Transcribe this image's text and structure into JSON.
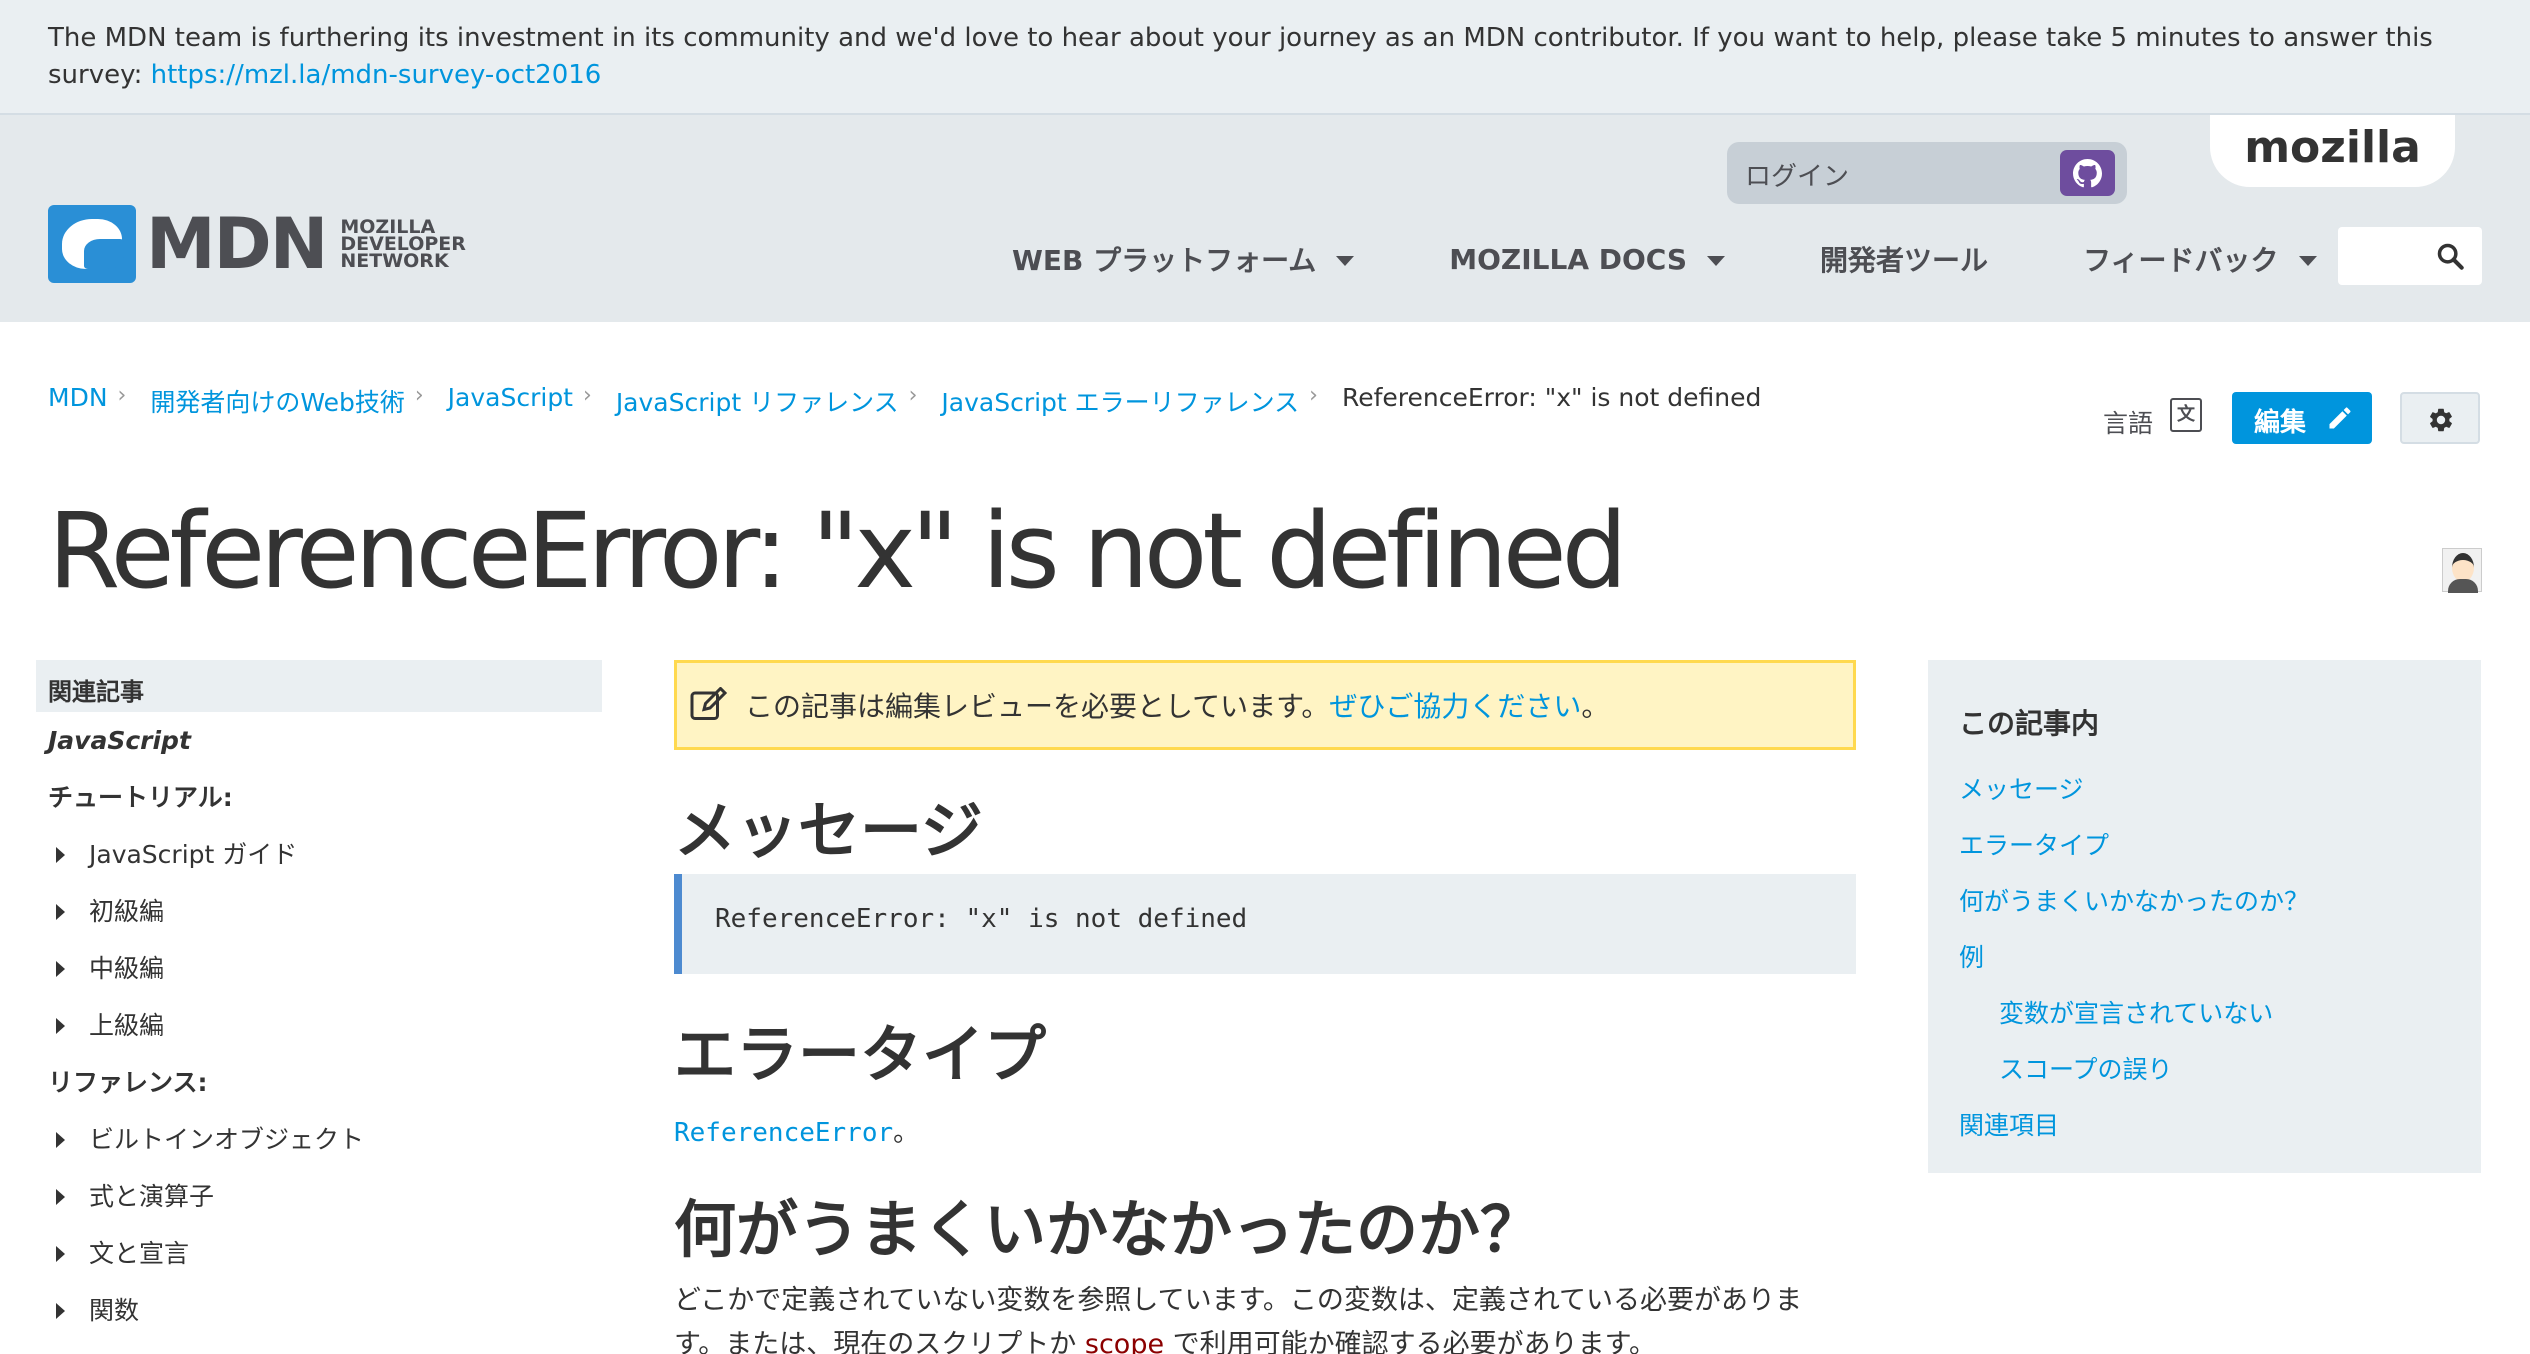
{
  "survey": {
    "text": "The MDN team is furthering its investment in its community and we'd love to hear about your journey as an MDN contributor. If you want to help, please take 5 minutes to answer this survey: ",
    "link": "https://mzl.la/mdn-survey-oct2016"
  },
  "header": {
    "logo_text": "MDN",
    "logo_sub_1": "MOZILLA",
    "logo_sub_2": "DEVELOPER",
    "logo_sub_3": "NETWORK",
    "mozilla_tab": "mozilla",
    "login_label": "ログイン",
    "nav": [
      {
        "label": "WEB プラットフォーム",
        "has_caret": true
      },
      {
        "label": "MOZILLA DOCS",
        "has_caret": true
      },
      {
        "label": "開発者ツール",
        "has_caret": false
      },
      {
        "label": "フィードバック",
        "has_caret": true
      }
    ],
    "search_icon": "search-icon"
  },
  "breadcrumbs": {
    "items": [
      "MDN",
      "開発者向けのWeb技術",
      "JavaScript",
      "JavaScript リファレンス",
      "JavaScript エラーリファレンス"
    ],
    "current": "ReferenceError: \"x\" is not defined"
  },
  "page_tools": {
    "language_label": "言語",
    "edit_label": "編集"
  },
  "page": {
    "title": "ReferenceError: \"x\" is not defined"
  },
  "sidebar": {
    "heading": "関連記事",
    "javascript_label": "JavaScript",
    "tutorials_label": "チュートリアル:",
    "tutorials": [
      "JavaScript ガイド",
      "初級編",
      "中級編",
      "上級編"
    ],
    "references_label": "リファレンス:",
    "references": [
      "ビルトインオブジェクト",
      "式と演算子",
      "文と宣言",
      "関数"
    ]
  },
  "content": {
    "notice_text": "この記事は編集レビューを必要としています。",
    "notice_link": "ぜひご協力ください",
    "notice_end": "。",
    "h_message": "メッセージ",
    "message_code": "ReferenceError: \"x\" is not defined",
    "h_error_type": "エラータイプ",
    "error_type_link": "ReferenceError",
    "error_type_end": "。",
    "h_what_wrong": "何がうまくいかなかったのか？",
    "para_1": "どこかで定義されていない変数を参照しています。この変数は、定義されている必要がありま",
    "para_2a": "す。または、現在のスクリプトか ",
    "para_scope": "scope",
    "para_2b": " で利用可能か確認する必要があります。"
  },
  "toc": {
    "title": "この記事内",
    "items": [
      "メッセージ",
      "エラータイプ",
      "何がうまくいかなかったのか？",
      "例"
    ],
    "sub_items": [
      "変数が宣言されていない",
      "スコープの誤り"
    ],
    "last_item": "関連項目"
  },
  "colors": {
    "link": "#0095dd",
    "header_bg": "#e4e9ec",
    "notice_bg": "#fff4c4",
    "notice_border": "#ffd94f",
    "edit_button": "#0095dd",
    "github_button": "#6e4d9e"
  }
}
